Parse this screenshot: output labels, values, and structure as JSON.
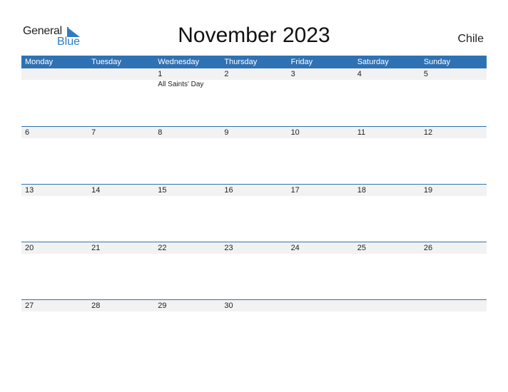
{
  "logo": {
    "general": "General",
    "blue": "Blue"
  },
  "title": "November 2023",
  "country": "Chile",
  "colors": {
    "header": "#2f72b3",
    "strip": "#f2f2f2",
    "brand": "#2f7bc4"
  },
  "weekdays": [
    "Monday",
    "Tuesday",
    "Wednesday",
    "Thursday",
    "Friday",
    "Saturday",
    "Sunday"
  ],
  "weeks": [
    [
      {
        "d": ""
      },
      {
        "d": ""
      },
      {
        "d": "1",
        "e": "All Saints' Day"
      },
      {
        "d": "2"
      },
      {
        "d": "3"
      },
      {
        "d": "4"
      },
      {
        "d": "5"
      }
    ],
    [
      {
        "d": "6"
      },
      {
        "d": "7"
      },
      {
        "d": "8"
      },
      {
        "d": "9"
      },
      {
        "d": "10"
      },
      {
        "d": "11"
      },
      {
        "d": "12"
      }
    ],
    [
      {
        "d": "13"
      },
      {
        "d": "14"
      },
      {
        "d": "15"
      },
      {
        "d": "16"
      },
      {
        "d": "17"
      },
      {
        "d": "18"
      },
      {
        "d": "19"
      }
    ],
    [
      {
        "d": "20"
      },
      {
        "d": "21"
      },
      {
        "d": "22"
      },
      {
        "d": "23"
      },
      {
        "d": "24"
      },
      {
        "d": "25"
      },
      {
        "d": "26"
      }
    ],
    [
      {
        "d": "27"
      },
      {
        "d": "28"
      },
      {
        "d": "29"
      },
      {
        "d": "30"
      },
      {
        "d": ""
      },
      {
        "d": ""
      },
      {
        "d": ""
      }
    ]
  ]
}
